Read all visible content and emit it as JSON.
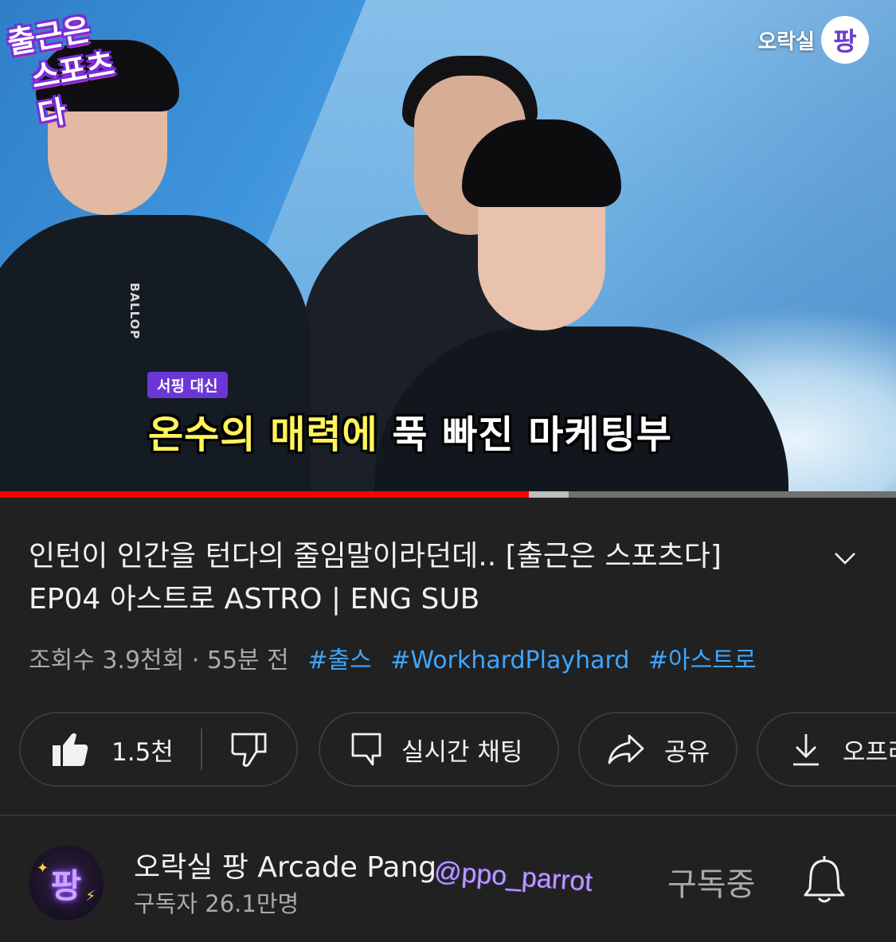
{
  "video": {
    "show_logo_line1": "출근은",
    "show_logo_line2": "스포츠다",
    "channel_bug_text": "오락실",
    "channel_bug_char": "팡",
    "shirt_brand": "BALLOP",
    "subtitle_small": "서핑 대신",
    "subtitle_yellow": "온수의 매력에",
    "subtitle_white": " 푹 빠진 마케팅부",
    "progress_played_fraction": 0.59,
    "progress_buffered_fraction": 0.635,
    "colors": {
      "played": "#ff0000",
      "buffer": "#bdbdbd",
      "track": "#707070"
    }
  },
  "info": {
    "title_line1": "인턴이 인간을 턴다의 줄임말이라던데.. [출근은 스포츠다]",
    "title_line2": "EP04 아스트로 ASTRO | ENG SUB",
    "expand_icon": "chevron-down-icon",
    "views": "조회수 3.9천회 · 55분 전",
    "hashtags": [
      "#출스",
      "#WorkhardPlayhard",
      "#아스트로"
    ],
    "hashtag_color": "#3ea6ff"
  },
  "actions": {
    "like_icon": "thumbs-up-icon",
    "like_count": "1.5천",
    "dislike_icon": "thumbs-down-icon",
    "chat_icon": "chat-icon",
    "chat_label": "실시간 채팅",
    "share_icon": "share-icon",
    "share_label": "공유",
    "download_icon": "download-icon",
    "download_label": "오프라"
  },
  "channel": {
    "avatar_text": "팡",
    "name": "오락실 팡 Arcade Pang",
    "subscribers": "구독자 26.1만명",
    "subscribe_label": "구독중",
    "bell_icon": "bell-icon",
    "watermark": "@ppo_parrot"
  }
}
